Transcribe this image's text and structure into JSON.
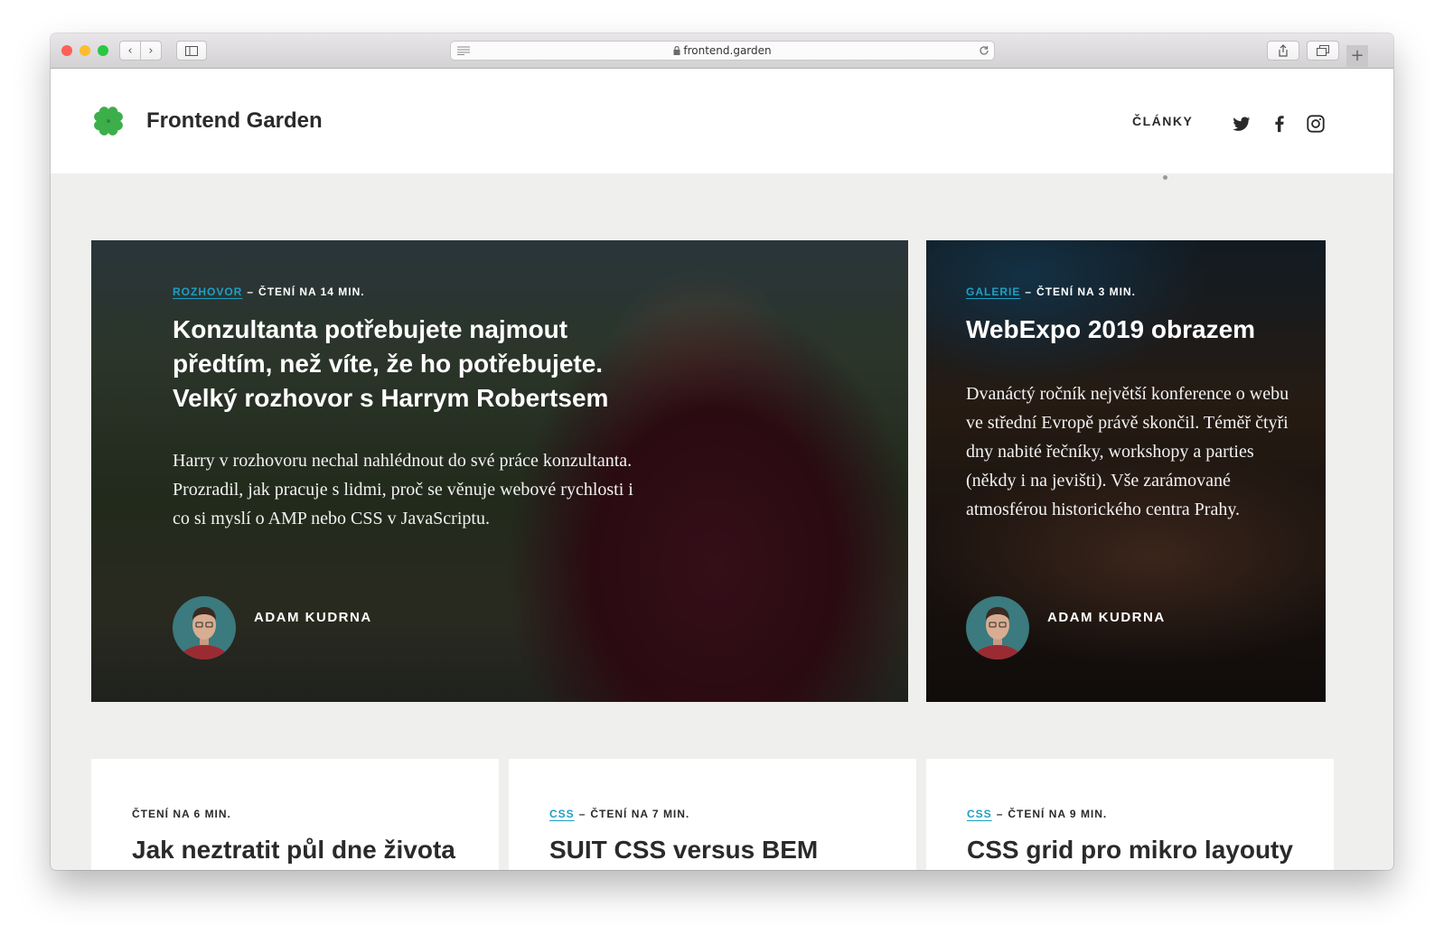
{
  "browser": {
    "url": "frontend.garden",
    "colors": {
      "close": "#ff5f57",
      "minimize": "#febc2e",
      "zoom": "#28c840"
    }
  },
  "site": {
    "brand": "Frontend Garden",
    "nav": [
      {
        "label": "ČLÁNKY"
      }
    ],
    "social": [
      "twitter-icon",
      "facebook-icon",
      "instagram-icon"
    ],
    "accent_color": "#1ea0c4"
  },
  "featured": [
    {
      "category": "ROZHOVOR",
      "reading_time": "ČTENÍ NA 14 MIN.",
      "title": "Konzultanta potřebujete najmout předtím, než víte, že ho potřebujete. Velký rozhovor s Harrym Robertsem",
      "excerpt": "Harry v rozhovoru nechal nahlédnout do své práce konzultanta. Prozradil, jak pracuje s lidmi, proč se věnuje webové rychlosti i co si myslí o AMP nebo CSS v JavaScriptu.",
      "author": "ADAM KUDRNA"
    },
    {
      "category": "GALERIE",
      "reading_time": "ČTENÍ NA 3 MIN.",
      "title": "WebExpo 2019 obrazem",
      "excerpt": "Dvanáctý ročník největší konference o webu ve střední Evropě právě skončil. Téměř čtyři dny nabité řečníky, workshopy a parties (někdy i na jevišti). Vše zarámované atmosférou historického centra Prahy.",
      "author": "ADAM KUDRNA"
    }
  ],
  "articles": [
    {
      "category": "",
      "reading_time": "ČTENÍ NA 6 MIN.",
      "title": "Jak neztratit půl dne života kvůli středníku"
    },
    {
      "category": "CSS",
      "reading_time": "ČTENÍ NA 7 MIN.",
      "title": "SUIT CSS versus BEM"
    },
    {
      "category": "CSS",
      "reading_time": "ČTENÍ NA 9 MIN.",
      "title": "CSS grid pro mikro layouty"
    }
  ]
}
